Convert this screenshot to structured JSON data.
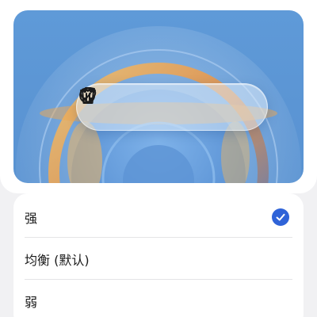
{
  "toolbar": {
    "buttons": [
      {
        "name": "refresh-button",
        "icon": "refresh-icon"
      },
      {
        "name": "favorite-button",
        "icon": "heart-icon"
      },
      {
        "name": "delete-button",
        "icon": "trash-icon"
      },
      {
        "name": "more-button",
        "icon": "dots-grid-icon"
      }
    ]
  },
  "options": [
    {
      "label": "强",
      "selected": true
    },
    {
      "label": "均衡 (默认)",
      "selected": false
    },
    {
      "label": "弱",
      "selected": false
    }
  ],
  "colors": {
    "accent": "#2f63d8",
    "wallpaper_blue": "#5f9ad8",
    "wallpaper_orange": "#f2a14a"
  }
}
